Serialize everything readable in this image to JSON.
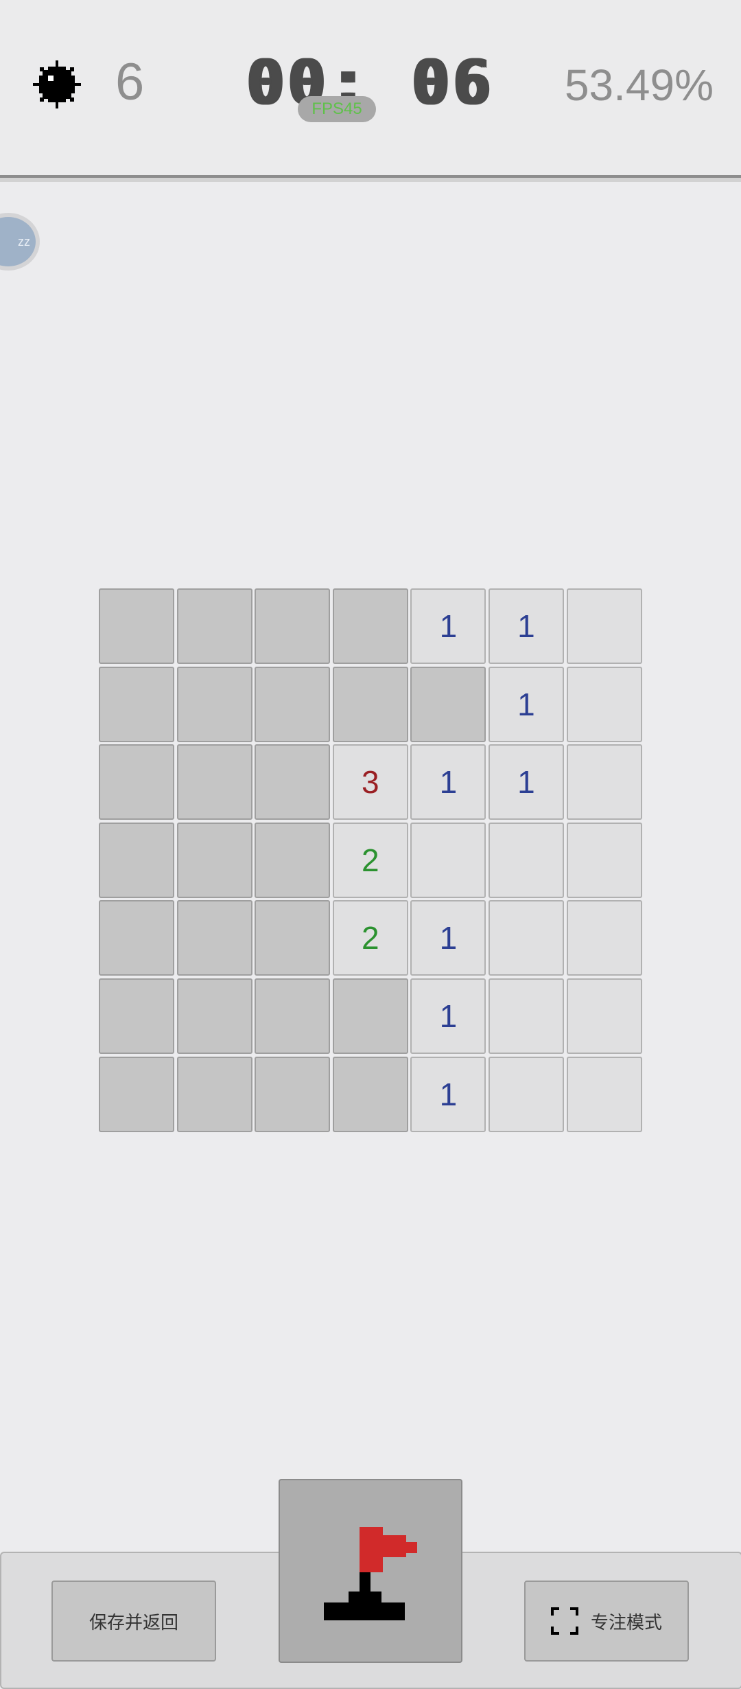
{
  "header": {
    "mine_icon": "mine-icon",
    "mines_remaining": "6",
    "timer": "00: 06",
    "fps": "FPS45",
    "progress_percent": "53.49%"
  },
  "side_bubble": {
    "text": "zz"
  },
  "board": {
    "rows": 7,
    "cols": 7,
    "cells": [
      [
        "c",
        "c",
        "c",
        "c",
        "1",
        "1",
        "o"
      ],
      [
        "c",
        "c",
        "c",
        "c",
        "c",
        "1",
        "o"
      ],
      [
        "c",
        "c",
        "c",
        "3",
        "1",
        "1",
        "o"
      ],
      [
        "c",
        "c",
        "c",
        "2",
        "o",
        "o",
        "o"
      ],
      [
        "c",
        "c",
        "c",
        "2",
        "1",
        "o",
        "o"
      ],
      [
        "c",
        "c",
        "c",
        "c",
        "1",
        "o",
        "o"
      ],
      [
        "c",
        "c",
        "c",
        "c",
        "1",
        "o",
        "o"
      ]
    ],
    "number_colors": {
      "1": "#2c3f93",
      "2": "#2b922f",
      "3": "#9a1f23"
    }
  },
  "controls": {
    "save_label": "保存并返回",
    "focus_label": "专注模式",
    "flag_mode_icon": "flag-icon",
    "focus_icon": "fullscreen-icon"
  }
}
